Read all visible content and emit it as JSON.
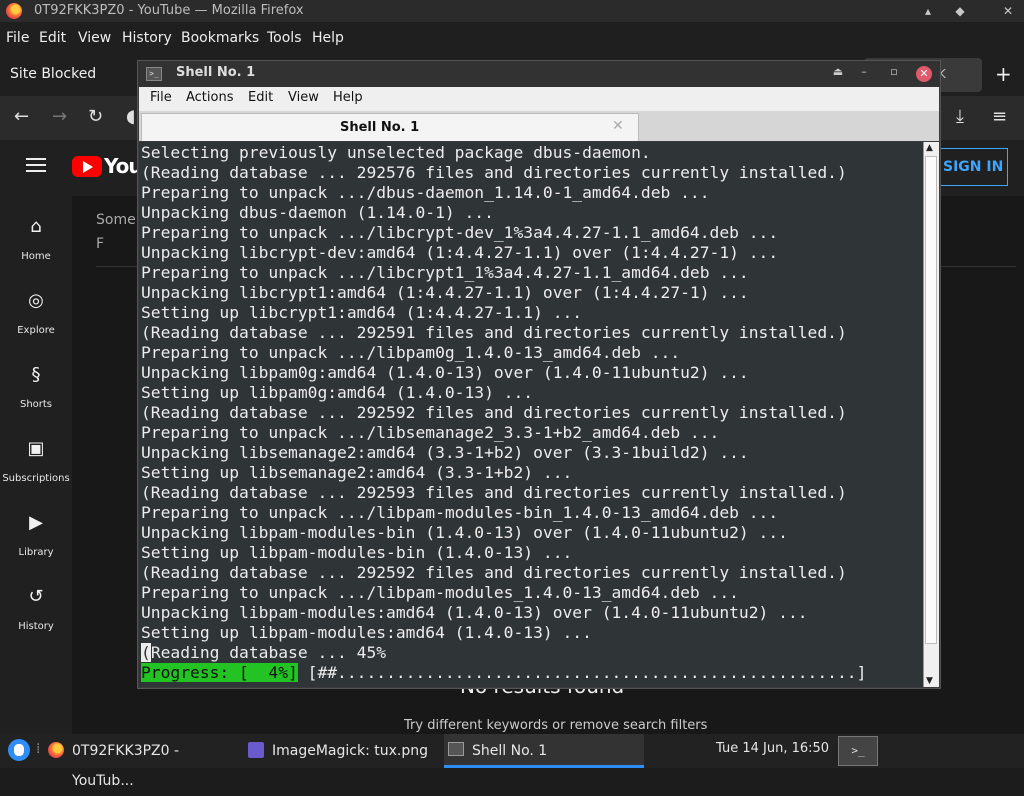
{
  "firefox": {
    "window_title": "0T92FKK3PZ0 - YouTube — Mozilla Firefox",
    "menu": [
      "File",
      "Edit",
      "View",
      "History",
      "Bookmarks",
      "Tools",
      "Help"
    ],
    "tab_blocked": "Site Blocked",
    "tab_partial": "K"
  },
  "youtube": {
    "logo_text": "YouT",
    "signin": "SIGN IN",
    "sidebar": [
      {
        "label": "Home",
        "icon": "home-icon",
        "glyph": "⌂"
      },
      {
        "label": "Explore",
        "icon": "compass-icon",
        "glyph": "◎"
      },
      {
        "label": "Shorts",
        "icon": "shorts-icon",
        "glyph": "§"
      },
      {
        "label": "Subscriptions",
        "icon": "subscriptions-icon",
        "glyph": "▣"
      },
      {
        "label": "Library",
        "icon": "library-icon",
        "glyph": "▶"
      },
      {
        "label": "History",
        "icon": "history-icon",
        "glyph": "↺"
      }
    ],
    "main_text_1": "Some",
    "main_text_2": "F",
    "no_results": "No results found",
    "try_hint": "Try different keywords or remove search filters"
  },
  "shell": {
    "title": "Shell No. 1",
    "menu": [
      "File",
      "Actions",
      "Edit",
      "View",
      "Help"
    ],
    "tab_label": "Shell No. 1",
    "lines": [
      "Selecting previously unselected package dbus-daemon.",
      "(Reading database ... 292576 files and directories currently installed.)",
      "Preparing to unpack .../dbus-daemon_1.14.0-1_amd64.deb ...",
      "Unpacking dbus-daemon (1.14.0-1) ...",
      "Preparing to unpack .../libcrypt-dev_1%3a4.4.27-1.1_amd64.deb ...",
      "Unpacking libcrypt-dev:amd64 (1:4.4.27-1.1) over (1:4.4.27-1) ...",
      "Preparing to unpack .../libcrypt1_1%3a4.4.27-1.1_amd64.deb ...",
      "Unpacking libcrypt1:amd64 (1:4.4.27-1.1) over (1:4.4.27-1) ...",
      "Setting up libcrypt1:amd64 (1:4.4.27-1.1) ...",
      "(Reading database ... 292591 files and directories currently installed.)",
      "Preparing to unpack .../libpam0g_1.4.0-13_amd64.deb ...",
      "Unpacking libpam0g:amd64 (1.4.0-13) over (1.4.0-11ubuntu2) ...",
      "Setting up libpam0g:amd64 (1.4.0-13) ...",
      "(Reading database ... 292592 files and directories currently installed.)",
      "Preparing to unpack .../libsemanage2_3.3-1+b2_amd64.deb ...",
      "Unpacking libsemanage2:amd64 (3.3-1+b2) over (3.3-1build2) ...",
      "Setting up libsemanage2:amd64 (3.3-1+b2) ...",
      "(Reading database ... 292593 files and directories currently installed.)",
      "Preparing to unpack .../libpam-modules-bin_1.4.0-13_amd64.deb ...",
      "Unpacking libpam-modules-bin (1.4.0-13) over (1.4.0-11ubuntu2) ...",
      "Setting up libpam-modules-bin (1.4.0-13) ...",
      "(Reading database ... 292592 files and directories currently installed.)",
      "Preparing to unpack .../libpam-modules_1.4.0-13_amd64.deb ...",
      "Unpacking libpam-modules:amd64 (1.4.0-13) over (1.4.0-11ubuntu2) ...",
      "Setting up libpam-modules:amd64 (1.4.0-13) ..."
    ],
    "cursor_char": "(",
    "current_line_rest": "Reading database ... 45%",
    "progress_label": "Progress: [  4%]",
    "progress_bar": " [##.....................................................]"
  },
  "taskbar": {
    "items": [
      {
        "label": "0T92FKK3PZ0 - YouTub...",
        "icon": "firefox-icon"
      },
      {
        "label": "ImageMagick: tux.png",
        "icon": "imagemagick-icon"
      },
      {
        "label": "Shell No. 1",
        "icon": "terminal-icon"
      }
    ],
    "clock": "Tue 14 Jun, 16:50"
  },
  "colors": {
    "accent": "#2f8ef5",
    "terminal_bg": "#2f3436",
    "progress_green": "#22c322",
    "yt_red": "#ff0000",
    "yt_link": "#3ea6ff"
  }
}
